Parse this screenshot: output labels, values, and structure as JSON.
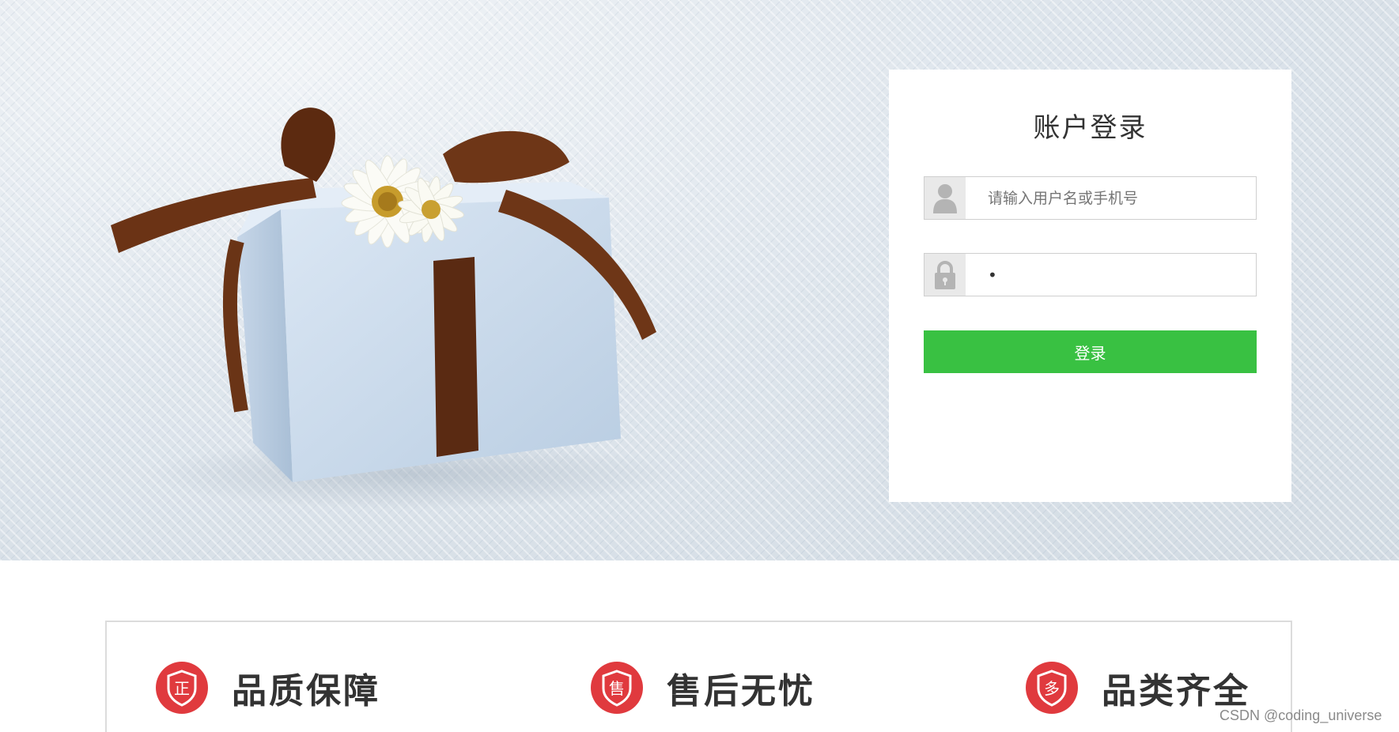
{
  "login": {
    "title": "账户登录",
    "username_placeholder": "请输入用户名或手机号",
    "username_value": "",
    "password_value": "•",
    "submit_label": "登录",
    "user_icon": "user-icon",
    "lock_icon": "lock-icon"
  },
  "features": [
    {
      "badge_char": "正",
      "label": "品质保障",
      "icon": "shield-badge-icon"
    },
    {
      "badge_char": "售",
      "label": "售后无忧",
      "icon": "shield-badge-icon"
    },
    {
      "badge_char": "多",
      "label": "品类齐全",
      "icon": "shield-badge-icon"
    }
  ],
  "watermark": "CSDN @coding_universe",
  "colors": {
    "accent_green": "#39c142",
    "badge_red": "#e03a3e",
    "text_dark": "#333333"
  }
}
